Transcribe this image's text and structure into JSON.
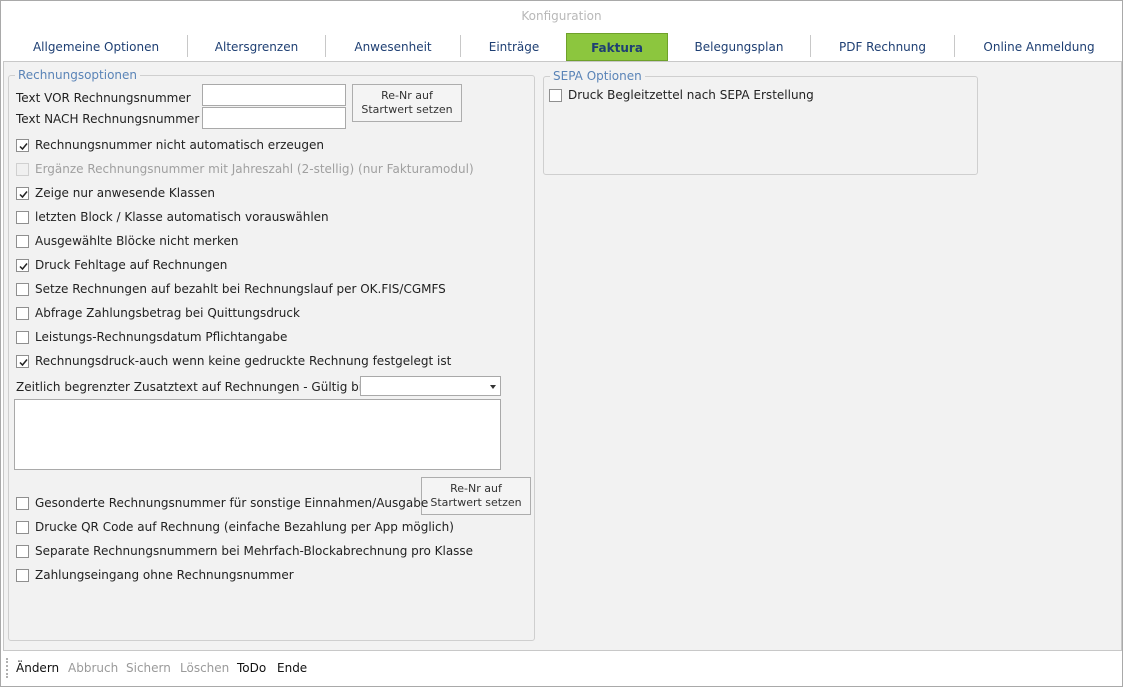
{
  "window": {
    "title": "Konfiguration"
  },
  "tabs": [
    {
      "label": "Allgemeine Optionen"
    },
    {
      "label": "Altersgrenzen"
    },
    {
      "label": "Anwesenheit"
    },
    {
      "label": "Einträge"
    },
    {
      "label": "Faktura"
    },
    {
      "label": "Belegungsplan"
    },
    {
      "label": "PDF Rechnung"
    },
    {
      "label": "Online Anmeldung"
    }
  ],
  "active_tab": "Faktura",
  "rechnungsoptionen": {
    "title": "Rechnungsoptionen",
    "text_vor_label": "Text VOR Rechnungsnummer",
    "text_vor_value": "",
    "text_nach_label": "Text NACH Rechnungsnummer",
    "text_nach_value": "",
    "renr_button": "Re-Nr auf\nStartwert setzen",
    "checkboxes": [
      {
        "label": "Rechnungsnummer nicht automatisch erzeugen",
        "checked": true,
        "enabled": true
      },
      {
        "label": "Ergänze Rechnungsnummer mit Jahreszahl (2-stellig) (nur Fakturamodul)",
        "checked": false,
        "enabled": false
      },
      {
        "label": "Zeige nur anwesende Klassen",
        "checked": true,
        "enabled": true
      },
      {
        "label": "letzten Block / Klasse automatisch vorauswählen",
        "checked": false,
        "enabled": true
      },
      {
        "label": "Ausgewählte Blöcke nicht merken",
        "checked": false,
        "enabled": true
      },
      {
        "label": "Druck Fehltage auf Rechnungen",
        "checked": true,
        "enabled": true
      },
      {
        "label": "Setze Rechnungen auf bezahlt bei Rechnungslauf per OK.FIS/CGMFS",
        "checked": false,
        "enabled": true
      },
      {
        "label": "Abfrage Zahlungsbetrag bei Quittungsdruck",
        "checked": false,
        "enabled": true
      },
      {
        "label": "Leistungs-Rechnungsdatum Pflichtangabe",
        "checked": false,
        "enabled": true
      },
      {
        "label": "Rechnungsdruck-auch wenn keine gedruckte Rechnung festgelegt ist",
        "checked": true,
        "enabled": true
      }
    ],
    "zusatztext_label": "Zeitlich begrenzter Zusatztext auf Rechnungen - Gültig bis",
    "zusatztext_date": "",
    "zusatztext_value": "",
    "checkboxes2": [
      {
        "label": "Gesonderte Rechnungsnummer für sonstige Einnahmen/Ausgabe",
        "checked": false,
        "enabled": true
      },
      {
        "label": "Drucke QR Code auf Rechnung (einfache Bezahlung per App möglich)",
        "checked": false,
        "enabled": true
      },
      {
        "label": "Separate Rechnungsnummern bei Mehrfach-Blockabrechnung pro Klasse",
        "checked": false,
        "enabled": true
      },
      {
        "label": "Zahlungseingang ohne Rechnungsnummer",
        "checked": false,
        "enabled": true
      }
    ],
    "renr_button2": "Re-Nr auf\nStartwert setzen"
  },
  "sepa": {
    "title": "SEPA Optionen",
    "checkbox": {
      "label": "Druck Begleitzettel nach SEPA Erstellung",
      "checked": false,
      "enabled": true
    }
  },
  "bottombar": [
    {
      "label": "Ändern",
      "enabled": true
    },
    {
      "label": "Abbruch",
      "enabled": false
    },
    {
      "label": "Sichern",
      "enabled": false
    },
    {
      "label": "Löschen",
      "enabled": false
    },
    {
      "label": "ToDo",
      "enabled": true
    },
    {
      "label": "Ende",
      "enabled": true
    }
  ]
}
